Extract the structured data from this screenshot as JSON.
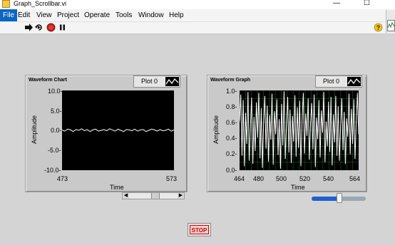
{
  "window": {
    "title": "Graph_Scrollbar.vi",
    "minimize": "—",
    "maximize": "☐",
    "close": "✕"
  },
  "menu": [
    "File",
    "Edit",
    "View",
    "Project",
    "Operate",
    "Tools",
    "Window",
    "Help"
  ],
  "toolbar": {
    "icons": [
      "run-arrow-icon",
      "run-continuously-icon",
      "abort-icon",
      "pause-icon",
      "help-icon"
    ]
  },
  "chart": {
    "title": "Waveform Chart",
    "legend": "Plot 0",
    "ylabel": "Amplitude",
    "xlabel": "Time",
    "yticks": [
      "10.0-",
      "5.0-",
      "0.0-",
      "-5.0-",
      "-10.0-"
    ],
    "xticks": [
      "473",
      "573"
    ],
    "trace_color": "#ffffff",
    "background": "#000000"
  },
  "graph": {
    "title": "Waveform Graph",
    "legend": "Plot 0",
    "ylabel": "Amplitude",
    "xlabel": "Time",
    "yticks": [
      "1.0-",
      "0.8-",
      "0.6-",
      "0.4-",
      "0.2-",
      "0.0-"
    ],
    "xticks": [
      "464",
      "480",
      "500",
      "520",
      "540",
      "564"
    ],
    "trace_color": "#ffffff",
    "grid_color": "#1b5e20",
    "background": "#000000"
  },
  "scrollbar": {
    "left_arrow": "◀",
    "right_arrow": "▶",
    "position": 0.42
  },
  "slider": {
    "value": 0.52,
    "accent": "#1f5fd1"
  },
  "stop_button": {
    "label": "STOP",
    "color": "#cc0000"
  },
  "chart_data": [
    {
      "type": "line",
      "title": "Waveform Chart",
      "xlabel": "Time",
      "ylabel": "Amplitude",
      "xlim": [
        473,
        573
      ],
      "ylim": [
        -10,
        10
      ],
      "series": [
        {
          "name": "Plot 0",
          "x_start": 473,
          "x_end": 573,
          "values": [
            0.1,
            -0.2,
            0.3,
            0.1,
            -0.3,
            0.2,
            0.0,
            0.4,
            -0.1,
            0.2,
            -0.3,
            0.1,
            0.3,
            -0.2,
            0.0,
            0.2,
            -0.1,
            0.4,
            0.1,
            -0.2,
            0.3,
            0.0,
            -0.3,
            0.2,
            0.1,
            -0.1,
            0.3,
            -0.2,
            0.1,
            0.2,
            -0.3,
            0.0,
            0.3,
            0.1,
            -0.2,
            0.2,
            -0.1,
            0.0,
            0.3,
            -0.2,
            0.1
          ]
        }
      ],
      "grid": false
    },
    {
      "type": "line",
      "title": "Waveform Graph",
      "xlabel": "Time",
      "ylabel": "Amplitude",
      "xlim": [
        464,
        564
      ],
      "ylim": [
        0,
        1
      ],
      "series": [
        {
          "name": "Plot 0",
          "x_start": 464,
          "x_end": 564,
          "values": [
            0.62,
            0.95,
            0.18,
            0.88,
            0.05,
            0.72,
            0.33,
            0.98,
            0.12,
            0.55,
            0.91,
            0.08,
            0.67,
            0.24,
            0.85,
            0.41,
            0.97,
            0.15,
            0.78,
            0.03,
            0.59,
            0.93,
            0.27,
            0.81,
            0.11,
            0.69,
            0.38,
            0.96,
            0.07,
            0.74,
            0.45,
            0.89,
            0.19,
            0.64,
            0.02,
            0.83,
            0.31,
            0.99,
            0.14,
            0.57,
            0.92,
            0.22,
            0.76,
            0.09,
            0.68,
            0.36,
            0.94,
            0.17,
            0.79,
            0.28,
            0.87,
            0.05,
            0.63,
            0.97,
            0.21,
            0.71,
            0.43,
            0.9,
            0.13,
            0.58,
            0.84,
            0.26,
            0.95,
            0.04,
            0.66,
            0.39,
            0.88,
            0.16,
            0.75,
            0.47,
            0.98,
            0.1,
            0.61,
            0.3,
            0.86,
            0.23,
            0.92,
            0.06,
            0.7,
            0.35,
            0.93,
            0.18,
            0.8,
            0.12,
            0.55,
            0.9,
            0.25,
            0.73,
            0.08,
            0.65,
            0.42,
            0.96,
            0.2,
            0.77,
            0.33,
            0.89,
            0.14,
            0.6,
            0.97,
            0.45
          ]
        }
      ],
      "grid": true
    }
  ]
}
